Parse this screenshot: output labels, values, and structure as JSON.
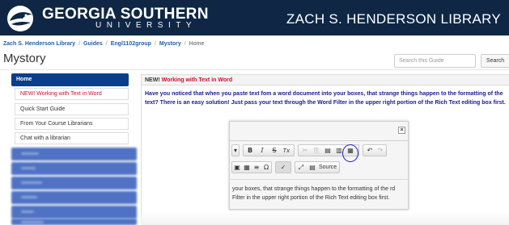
{
  "header": {
    "logo_main": "GEORGIA SOUTHERN",
    "logo_sub": "UNIVERSITY",
    "library_title": "ZACH S. HENDERSON LIBRARY",
    "logo_icon": "eagle-head-icon",
    "background_color": "#0f2745"
  },
  "breadcrumb": {
    "items": [
      "Zach S. Henderson Library",
      "Guides",
      "Engl1102group",
      "Mystory"
    ],
    "current": "Home",
    "separator": "/"
  },
  "page": {
    "title": "Mystory"
  },
  "search": {
    "placeholder": "Search this Guide",
    "button_label": "Search"
  },
  "sidebar": {
    "active_label": "Home",
    "items": [
      {
        "label": "NEW! Working with Text in Word",
        "selected": true
      },
      {
        "label": "Quick Start Guide",
        "selected": false
      },
      {
        "label": "From Your Course Librarians",
        "selected": false
      },
      {
        "label": "Chat with a librarian",
        "selected": false
      }
    ],
    "active_color": "#0a3e8c",
    "blurred_color": "#4f72c4"
  },
  "content": {
    "box_header_prefix": "NEW!",
    "box_header_title": "Working with Text in Word",
    "intro": "Have you noticed that when you paste text fom a word document into your boxes, that strange things happen to the formatting of the text? There is an easy solution! Just pass your text through the Word Filter in the upper right portion of the Rich Text editing box first.",
    "accent_color": "#c8102e",
    "intro_color": "#1a1a8c"
  },
  "dialog": {
    "close_label": "×",
    "source_label": "Source",
    "editor_text": "your boxes, that strange things happen to the formatting of the rd Filter in the upper right portion of the Rich Text editing box first.",
    "highlight_color": "#1a1ac0",
    "toolbar_row1": [
      {
        "name": "format-dropdown-icon",
        "glyph": "▾",
        "dim": false
      },
      {
        "name": "bold-icon",
        "glyph": "B",
        "dim": false
      },
      {
        "name": "italic-icon",
        "glyph": "I",
        "dim": false
      },
      {
        "name": "strike-icon",
        "glyph": "S",
        "dim": false
      },
      {
        "name": "clear-format-icon",
        "glyph": "Tx",
        "dim": false
      },
      {
        "name": "cut-icon",
        "glyph": "✂",
        "dim": true
      },
      {
        "name": "copy-icon",
        "glyph": "⎘",
        "dim": true
      },
      {
        "name": "paste-icon",
        "glyph": "▤",
        "dim": false
      },
      {
        "name": "paste-text-icon",
        "glyph": "▥",
        "dim": false
      },
      {
        "name": "paste-from-word-icon",
        "glyph": "▦",
        "dim": false
      },
      {
        "name": "undo-icon",
        "glyph": "↶",
        "dim": false
      },
      {
        "name": "redo-icon",
        "glyph": "↷",
        "dim": true
      }
    ],
    "toolbar_row2": [
      {
        "name": "image-icon",
        "glyph": "▣",
        "dim": false
      },
      {
        "name": "table-icon",
        "glyph": "▦",
        "dim": false
      },
      {
        "name": "horizontal-line-icon",
        "glyph": "≡",
        "dim": false
      },
      {
        "name": "special-char-icon",
        "glyph": "Ω",
        "dim": false
      },
      {
        "name": "spellcheck-icon",
        "glyph": "✓",
        "dim": false
      },
      {
        "name": "maximize-icon",
        "glyph": "⤢",
        "dim": false
      },
      {
        "name": "source-icon",
        "glyph": "▤",
        "dim": false
      }
    ]
  }
}
